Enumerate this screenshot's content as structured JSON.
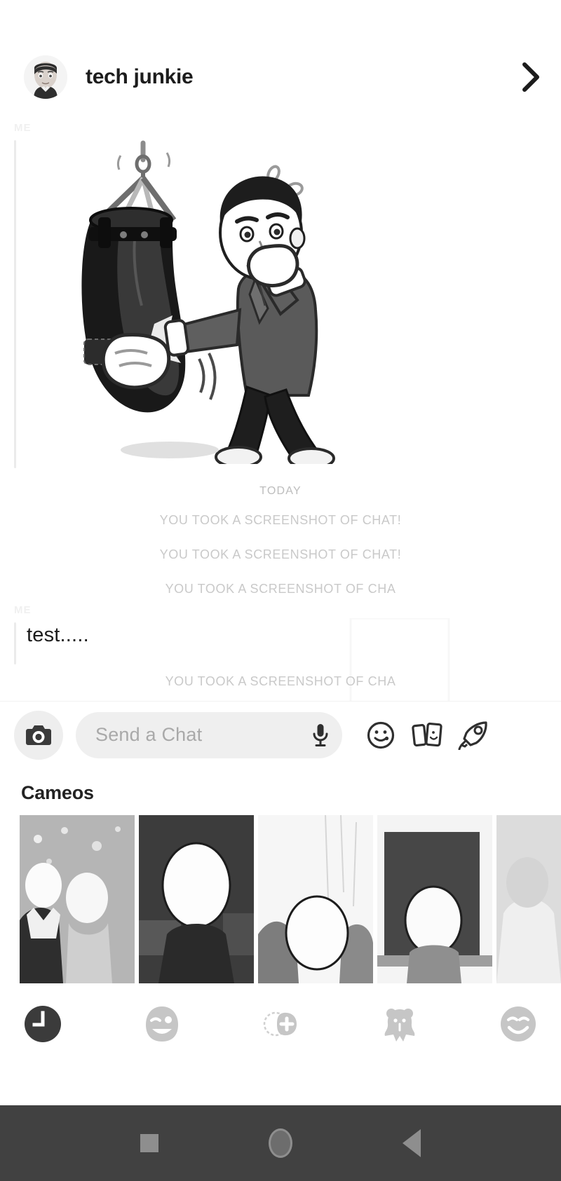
{
  "header": {
    "friend_name": "tech junkie",
    "avatar_icon": "bitmoji-avatar",
    "forward_icon": "chevron-right-icon"
  },
  "conversation": {
    "sticker_message": {
      "sender_label": "ME",
      "sticker_name": "bitmoji-boxing-punching-bag"
    },
    "day_divider": "TODAY",
    "system_notes": [
      "YOU TOOK A SCREENSHOT OF CHAT!",
      "YOU TOOK A SCREENSHOT OF CHAT!",
      "YOU TOOK A SCREENSHOT OF CHA",
      "YOU TOOK A SCREENSHOT OF CHA"
    ],
    "text_message": {
      "sender_label": "ME",
      "text": "test....."
    }
  },
  "input_bar": {
    "camera_icon": "camera-icon",
    "placeholder": "Send a Chat",
    "mic_icon": "microphone-icon",
    "sticker_icon": "smiley-sticker-icon",
    "cameo_icon": "cameo-cards-icon",
    "rocket_icon": "rocket-icon"
  },
  "cameos": {
    "title": "Cameos",
    "cards": [
      {
        "name": "cameo-card-1",
        "bg": "#bfbfbf",
        "dark": false
      },
      {
        "name": "cameo-card-2",
        "bg": "#3c3c3c",
        "dark": true
      },
      {
        "name": "cameo-card-3",
        "bg": "#f2f2f2",
        "dark": false
      },
      {
        "name": "cameo-card-4",
        "bg": "#4a4a4a",
        "dark": true
      },
      {
        "name": "cameo-card-5",
        "bg": "#dcdcdc",
        "dark": false
      }
    ],
    "tabs": [
      {
        "name": "tab-recent",
        "icon": "clock-icon",
        "active": true
      },
      {
        "name": "tab-wink",
        "icon": "wink-smiley-icon",
        "active": false
      },
      {
        "name": "tab-add-sticker",
        "icon": "add-sticker-icon",
        "active": false
      },
      {
        "name": "tab-mascot",
        "icon": "bear-mascot-icon",
        "active": false
      },
      {
        "name": "tab-smiley",
        "icon": "smiley-icon",
        "active": false
      }
    ]
  },
  "nav_bar": {
    "recents": "recents-square-icon",
    "home": "home-circle-icon",
    "back": "back-triangle-icon"
  },
  "colors": {
    "background": "#ffffff",
    "text_primary": "#1c1c1c",
    "text_muted": "#c9c9c9",
    "sender_label": "#f0f0f0",
    "input_field": "#efefef",
    "nav_bar": "#414141"
  }
}
